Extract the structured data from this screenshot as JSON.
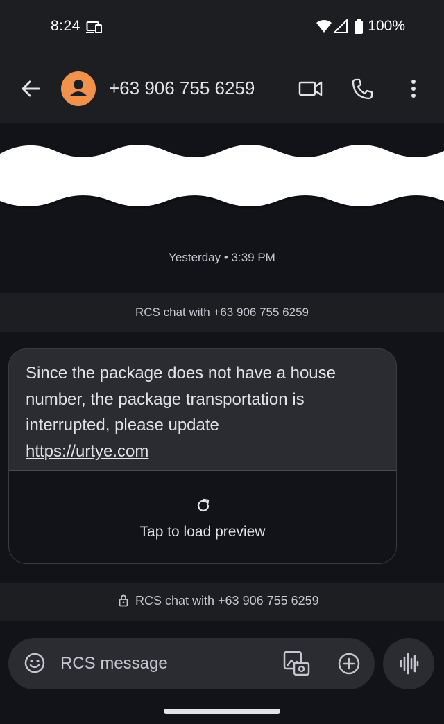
{
  "status_bar": {
    "time": "8:24",
    "battery": "100%"
  },
  "app_bar": {
    "contact": "+63 906 755 6259"
  },
  "conversation": {
    "timestamp": "Yesterday • 3:39 PM",
    "rcs_banner": "RCS chat with +63 906 755 6259",
    "message": {
      "text": "Since the package does not have a house number, the package transportation is interrupted, please update",
      "link": "https://urtye.com",
      "preview_label": "Tap to load preview"
    },
    "rcs_footer": "RCS chat with +63 906 755 6259"
  },
  "compose": {
    "placeholder": "RCS message"
  },
  "colors": {
    "avatar": "#f0924c",
    "background": "#121318",
    "surface": "#1d1e22",
    "bubble": "#2b2c31"
  }
}
